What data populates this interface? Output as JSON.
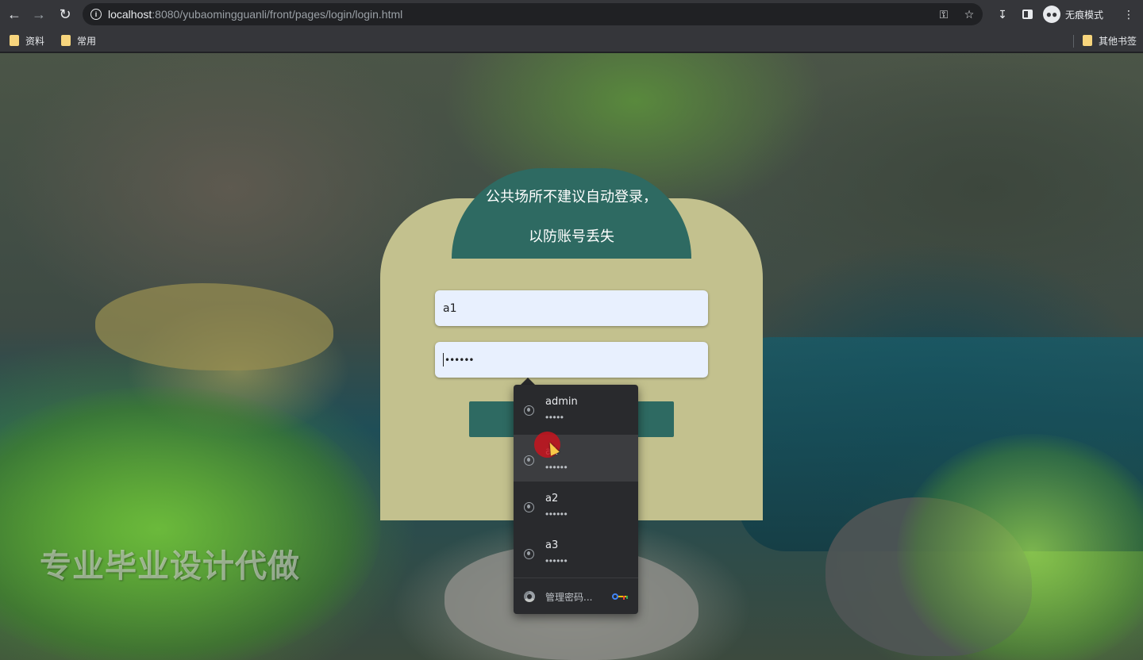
{
  "browser": {
    "url_host": "localhost",
    "url_rest": ":8080/yubaomingguanli/front/pages/login/login.html",
    "incognito_label": "无痕模式",
    "bookmarks": [
      {
        "label": "资料"
      },
      {
        "label": "常用"
      }
    ],
    "other_bookmarks": "其他书签"
  },
  "page": {
    "watermark": "专业毕业设计代做",
    "login": {
      "header_text": "公共场所不建议自动登录，以防账号丢失",
      "username_value": "a1",
      "password_value": "••••••"
    }
  },
  "autofill": {
    "entries": [
      {
        "username": "admin",
        "password": "•••••"
      },
      {
        "username": "a1",
        "password": "••••••"
      },
      {
        "username": "a2",
        "password": "••••••"
      },
      {
        "username": "a3",
        "password": "••••••"
      }
    ],
    "manage_label": "管理密码..."
  },
  "colors": {
    "card_bg": "#c3c18e",
    "accent": "#2e6a62",
    "autofill_field": "#e8f0fe",
    "dropdown_bg": "#292a2d"
  }
}
